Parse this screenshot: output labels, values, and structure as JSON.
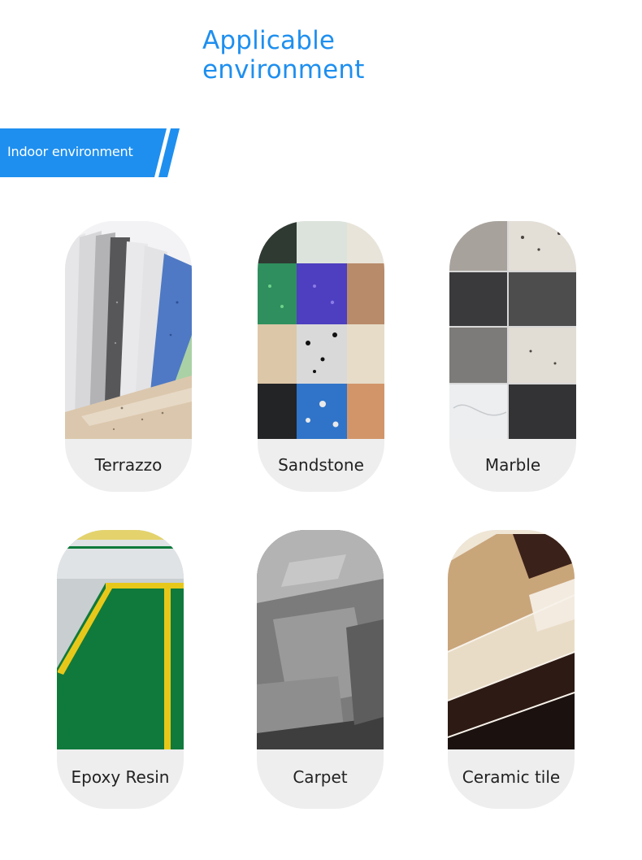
{
  "header": {
    "title_line1": "Applicable",
    "title_line2": "environment"
  },
  "section_tag": {
    "label": "Indoor environment",
    "color": "#1e8fef"
  },
  "materials": [
    {
      "label": "Terrazzo"
    },
    {
      "label": "Sandstone"
    },
    {
      "label": "Marble"
    },
    {
      "label": "Epoxy Resin"
    },
    {
      "label": "Carpet"
    },
    {
      "label": "Ceramic tile"
    }
  ]
}
